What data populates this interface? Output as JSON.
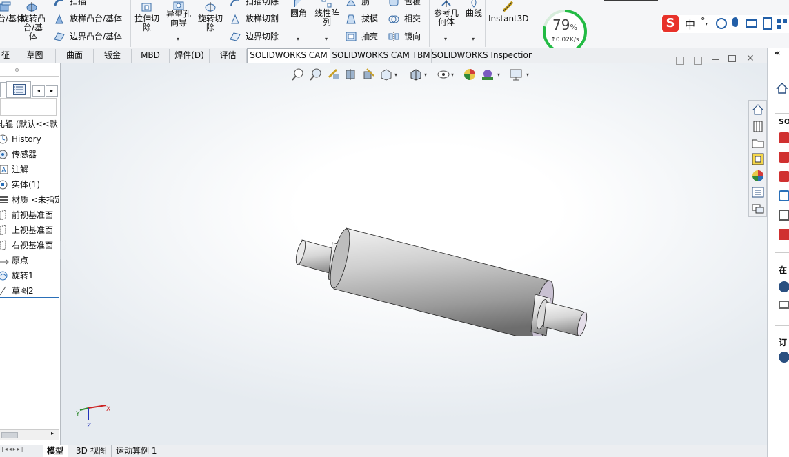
{
  "ribbon": {
    "features": {
      "boss_extrude": "凸台/基体",
      "revolve_boss": "旋转凸台/基体",
      "sweep": "扫描",
      "loft_boss": "放样凸台/基体",
      "boundary_boss": "边界凸台/基体",
      "extrude_cut": "拉伸切除",
      "hole_wizard": "异型孔向导",
      "revolve_cut": "旋转切除",
      "swept_cut": "扫描切除",
      "loft_cut": "放样切割",
      "boundary_cut": "边界切除",
      "fillet": "圆角",
      "linear_pattern": "线性阵列",
      "rib": "筋",
      "wrap": "包覆",
      "draft": "拔模",
      "intersect": "相交",
      "shell": "抽壳",
      "mirror": "镜向",
      "ref_geometry": "参考几何体",
      "curves": "曲线",
      "instant3d": "Instant3D"
    },
    "network": {
      "percent": "79",
      "percent_unit": "%",
      "speed": "↑0.02K/s"
    },
    "ime_label": "中",
    "ime_punct": "°,"
  },
  "tabs": [
    "征",
    "草图",
    "曲面",
    "钣金",
    "MBD",
    "焊件(D)",
    "评估",
    "SOLIDWORKS CAM",
    "SOLIDWORKS CAM TBM",
    "SOLIDWORKS Inspection"
  ],
  "feature_tree": {
    "root": "轧辊 (默认<<默",
    "items": [
      {
        "label": "History",
        "icon": "history-icon"
      },
      {
        "label": "传感器",
        "icon": "sensor-icon"
      },
      {
        "label": "注解",
        "icon": "annotation-icon"
      },
      {
        "label": "实体(1)",
        "icon": "solid-body-icon"
      },
      {
        "label": "材质 <未指定",
        "icon": "material-icon"
      },
      {
        "label": "前视基准面",
        "icon": "plane-icon"
      },
      {
        "label": "上视基准面",
        "icon": "plane-icon"
      },
      {
        "label": "右视基准面",
        "icon": "plane-icon"
      },
      {
        "label": "原点",
        "icon": "origin-icon"
      },
      {
        "label": "旋转1",
        "icon": "revolve-icon"
      },
      {
        "label": "草图2",
        "icon": "sketch-icon"
      }
    ]
  },
  "bottom_tabs": [
    "模型",
    "3D 视图",
    "运动算例 1"
  ],
  "triad": {
    "x": "X",
    "y": "Y",
    "z": "Z"
  },
  "right_pane": {
    "header": "SO",
    "section1": "在",
    "section2": "订"
  },
  "colors": {
    "accent_green": "#22bb44",
    "part_face": "#c9c9c9",
    "part_end": "#c8bfd0",
    "ime_red": "#e8322a"
  }
}
